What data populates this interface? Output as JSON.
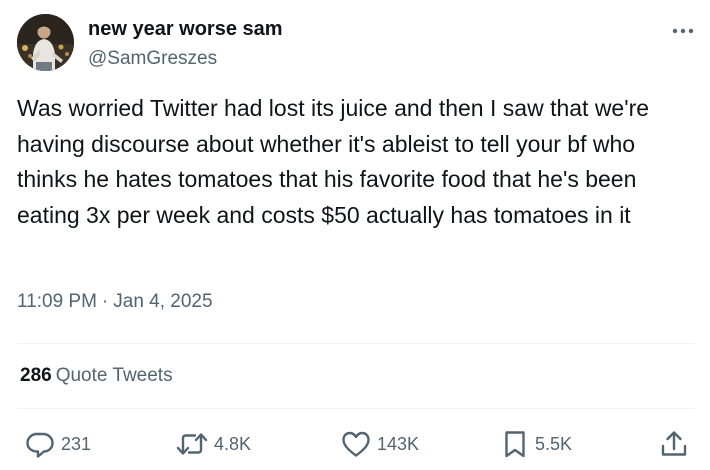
{
  "author": {
    "name": "new year worse sam",
    "handle": "@SamGreszes"
  },
  "tweet": {
    "text": "Was worried Twitter had lost its juice and then I saw that we're having discourse about whether it's ableist to tell your bf who thinks he hates tomatoes that his favorite food that he's been eating 3x per week and costs $50 actually has tomatoes in it",
    "time": "11:09 PM",
    "separator": "·",
    "date": "Jan 4, 2025"
  },
  "quotes": {
    "count": "286",
    "label": "Quote Tweets"
  },
  "actions": {
    "replies": "231",
    "retweets": "4.8K",
    "likes": "143K",
    "bookmarks": "5.5K"
  },
  "icons": {
    "more": "more-horizontal-icon",
    "reply": "reply-icon",
    "retweet": "retweet-icon",
    "like": "heart-icon",
    "bookmark": "bookmark-icon",
    "share": "share-icon"
  },
  "colors": {
    "text": "#0f1419",
    "secondary": "#536471",
    "divider": "#eff3f4"
  }
}
